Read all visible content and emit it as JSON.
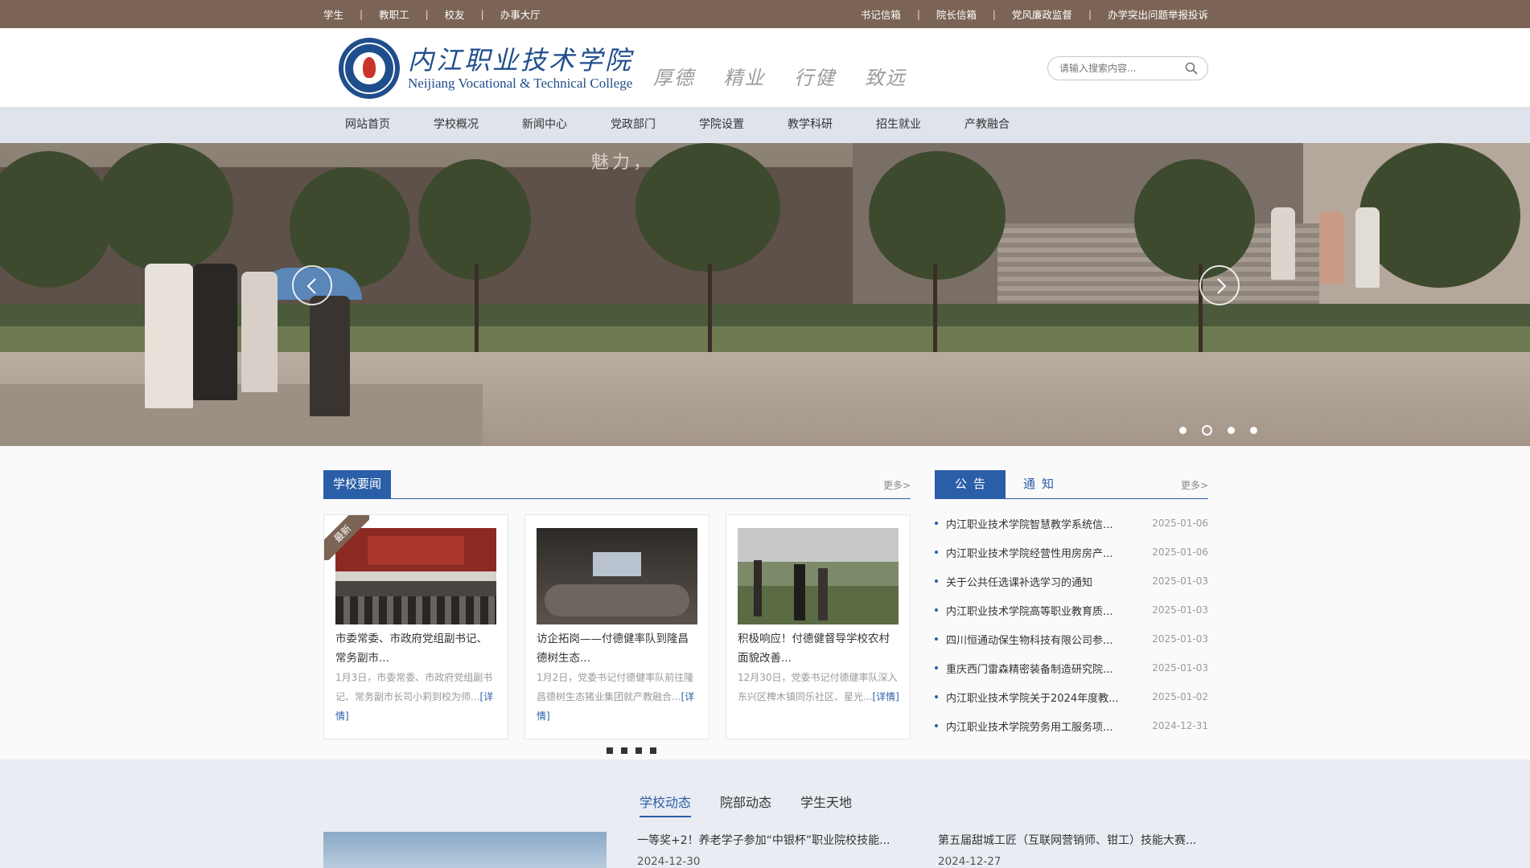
{
  "topbar": {
    "left_links": [
      "学生",
      "教职工",
      "校友",
      "办事大厅"
    ],
    "right_links": [
      "书记信箱",
      "院长信箱",
      "党风廉政监督",
      "办学突出问题举报投诉"
    ],
    "separator": "|"
  },
  "header": {
    "brand_cn": "内江职业技术学院",
    "brand_en": "Neijiang Vocational & Technical College",
    "motto": [
      "厚德",
      "精业",
      "行健",
      "致远"
    ],
    "search_placeholder": "请输入搜索内容..."
  },
  "nav": {
    "items": [
      "网站首页",
      "学校概况",
      "新闻中心",
      "党政部门",
      "学院设置",
      "教学科研",
      "招生就业",
      "产教融合"
    ]
  },
  "banner": {
    "sign_text": "魅力，",
    "slide_count": 4,
    "active_slide": 2
  },
  "news": {
    "title": "学校要闻",
    "more": "更多>",
    "badge": "最新",
    "cards": [
      {
        "title": "市委常委、市政府党组副书记、常务副市...",
        "desc": "1月3日，市委常委、市政府党组副书记、常务副市长司小莉到校为师...",
        "detail": "[详情]"
      },
      {
        "title": "访企拓岗——付德健率队到隆昌德树生态...",
        "desc": "1月2日，党委书记付德健率队前往隆昌德树生态猪业集团就产教融合...",
        "detail": "[详情]"
      },
      {
        "title": "积极响应！付德健督导学校农村面貌改善...",
        "desc": "12月30日，党委书记付德健率队深入东兴区椑木镇同乐社区、星光...",
        "detail": "[详情]"
      }
    ],
    "pages": 4
  },
  "notice": {
    "tab_active": "公告",
    "tab_inactive": "通知",
    "more": "更多>",
    "items": [
      {
        "text": "内江职业技术学院智慧教学系统信...",
        "date": "2025-01-06"
      },
      {
        "text": "内江职业技术学院经营性用房房产...",
        "date": "2025-01-06"
      },
      {
        "text": "关于公共任选课补选学习的通知",
        "date": "2025-01-03"
      },
      {
        "text": "内江职业技术学院高等职业教育质...",
        "date": "2025-01-03"
      },
      {
        "text": "四川恒通动保生物科技有限公司参...",
        "date": "2025-01-03"
      },
      {
        "text": "重庆西门雷森精密装备制造研究院...",
        "date": "2025-01-03"
      },
      {
        "text": "内江职业技术学院关于2024年度教...",
        "date": "2025-01-02"
      },
      {
        "text": "内江职业技术学院劳务用工服务项...",
        "date": "2024-12-31"
      }
    ]
  },
  "dynamics": {
    "tabs": [
      "学校动态",
      "院部动态",
      "学生天地"
    ],
    "items": [
      {
        "title": "一等奖+2！养老学子参加“中银杯”职业院校技能...",
        "date": "2024-12-30"
      },
      {
        "title": "第五届甜城工匠（互联网营销师、钳工）技能大赛...",
        "date": "2024-12-27"
      }
    ]
  },
  "colors": {
    "topbar": "#7b6455",
    "accent": "#2a5ea8",
    "nav_bg": "#dfe3ec"
  }
}
